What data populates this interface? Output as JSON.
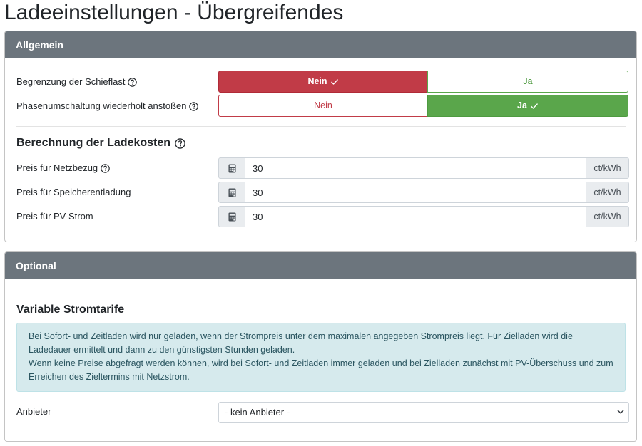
{
  "page": {
    "title": "Ladeeinstellungen - Übergreifendes"
  },
  "allgemein": {
    "header": "Allgemein",
    "schieflast": {
      "label": "Begrenzung der Schieflast",
      "no": "Nein",
      "yes": "Ja",
      "selected": "Nein"
    },
    "phasen": {
      "label": "Phasenumschaltung wiederholt anstoßen",
      "no": "Nein",
      "yes": "Ja",
      "selected": "Ja"
    },
    "kosten_title": "Berechnung der Ladekosten",
    "netzbezug": {
      "label": "Preis für Netzbezug",
      "value": "30",
      "unit": "ct/kWh"
    },
    "speicher": {
      "label": "Preis für Speicherentladung",
      "value": "30",
      "unit": "ct/kWh"
    },
    "pv": {
      "label": "Preis für PV-Strom",
      "value": "30",
      "unit": "ct/kWh"
    }
  },
  "optional": {
    "header": "Optional",
    "tarife_title": "Variable Stromtarife",
    "info_line1": "Bei Sofort- und Zeitladen wird nur geladen, wenn der Strompreis unter dem maximalen angegeben Strompreis liegt. Für Zielladen wird die Ladedauer ermittelt und dann zu den günstigsten Stunden geladen.",
    "info_line2": "Wenn keine Preise abgefragt werden können, wird bei Sofort- und Zeitladen immer geladen und bei Zielladen zunächst mit PV-Überschuss und zum Erreichen des Zieltermins mit Netzstrom.",
    "anbieter": {
      "label": "Anbieter",
      "selected": "- kein Anbieter -"
    }
  },
  "colors": {
    "header_bg": "#6c757d",
    "danger": "#c13b47",
    "success": "#5aa64b",
    "info_bg": "#d6eaed"
  },
  "icons": {
    "help": "question-circle-icon",
    "check": "check-icon",
    "calculator": "calculator-icon",
    "chevron": "chevron-down-icon"
  }
}
